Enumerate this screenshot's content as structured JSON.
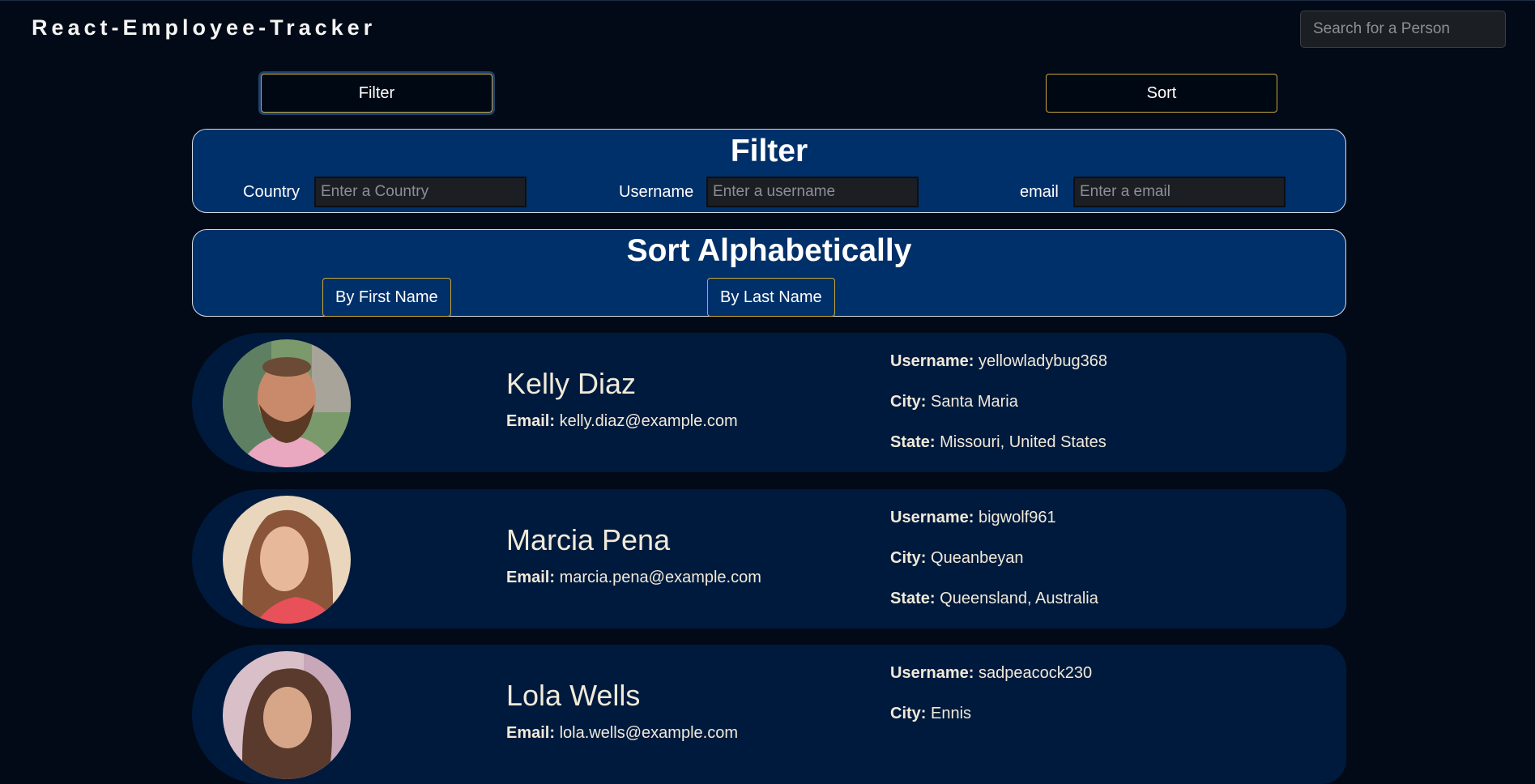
{
  "header": {
    "brand": "React-Employee-Tracker",
    "search_placeholder": "Search for a Person"
  },
  "controls": {
    "filter_label": "Filter",
    "sort_label": "Sort"
  },
  "filter_panel": {
    "title": "Filter",
    "country_label": "Country",
    "country_placeholder": "Enter a Country",
    "username_label": "Username",
    "username_placeholder": "Enter a username",
    "email_label": "email",
    "email_placeholder": "Enter a email"
  },
  "sort_panel": {
    "title": "Sort Alphabetically",
    "first_name_label": "By First Name",
    "last_name_label": "By Last Name"
  },
  "field_labels": {
    "email": "Email:",
    "username": "Username:",
    "city": "City:",
    "state": "State:"
  },
  "employees": [
    {
      "name": "Kelly Diaz",
      "email": "kelly.diaz@example.com",
      "username": "yellowladybug368",
      "city": "Santa Maria",
      "state": "Missouri, United States"
    },
    {
      "name": "Marcia Pena",
      "email": "marcia.pena@example.com",
      "username": "bigwolf961",
      "city": "Queanbeyan",
      "state": "Queensland, Australia"
    },
    {
      "name": "Lola Wells",
      "email": "lola.wells@example.com",
      "username": "sadpeacock230",
      "city": "Ennis",
      "state": ""
    }
  ]
}
